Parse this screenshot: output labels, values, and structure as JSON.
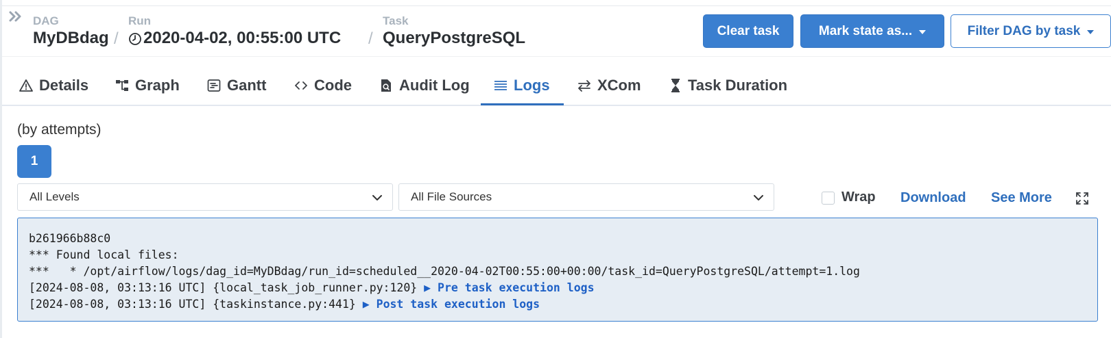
{
  "header": {
    "dag_label": "DAG",
    "dag_value": "MyDBdag",
    "run_label": "Run",
    "run_value": "2020-04-02, 00:55:00 UTC",
    "task_label": "Task",
    "task_value": "QueryPostgreSQL",
    "separator": "/"
  },
  "actions": {
    "clear_task": "Clear task",
    "mark_state": "Mark state as...",
    "filter_dag": "Filter DAG by task"
  },
  "tabs": [
    {
      "label": "Details",
      "icon": "warning-icon"
    },
    {
      "label": "Graph",
      "icon": "graph-icon"
    },
    {
      "label": "Gantt",
      "icon": "gantt-icon"
    },
    {
      "label": "Code",
      "icon": "code-icon"
    },
    {
      "label": "Audit Log",
      "icon": "audit-log-icon"
    },
    {
      "label": "Logs",
      "icon": "logs-icon",
      "active": true
    },
    {
      "label": "XCom",
      "icon": "xcom-icon"
    },
    {
      "label": "Task Duration",
      "icon": "hourglass-icon"
    }
  ],
  "logs": {
    "attempts_label": "(by attempts)",
    "attempts": [
      "1"
    ],
    "level_select": "All Levels",
    "source_select": "All File Sources",
    "wrap_label": "Wrap",
    "wrap_checked": false,
    "download_label": "Download",
    "see_more_label": "See More",
    "lines": [
      {
        "text": "b261966b88c0"
      },
      {
        "text": "*** Found local files:"
      },
      {
        "text": "***   * /opt/airflow/logs/dag_id=MyDBdag/run_id=scheduled__2020-04-02T00:55:00+00:00/task_id=QueryPostgreSQL/attempt=1.log"
      },
      {
        "text": "[2024-08-08, 03:13:16 UTC] {local_task_job_runner.py:120} ",
        "link": "▶ Pre task execution logs"
      },
      {
        "text": "[2024-08-08, 03:13:16 UTC] {taskinstance.py:441} ",
        "link": "▶ Post task execution logs"
      }
    ]
  },
  "colors": {
    "primary": "#3a7fd0",
    "link": "#2f6fbd",
    "log_background": "#e6edf4"
  }
}
